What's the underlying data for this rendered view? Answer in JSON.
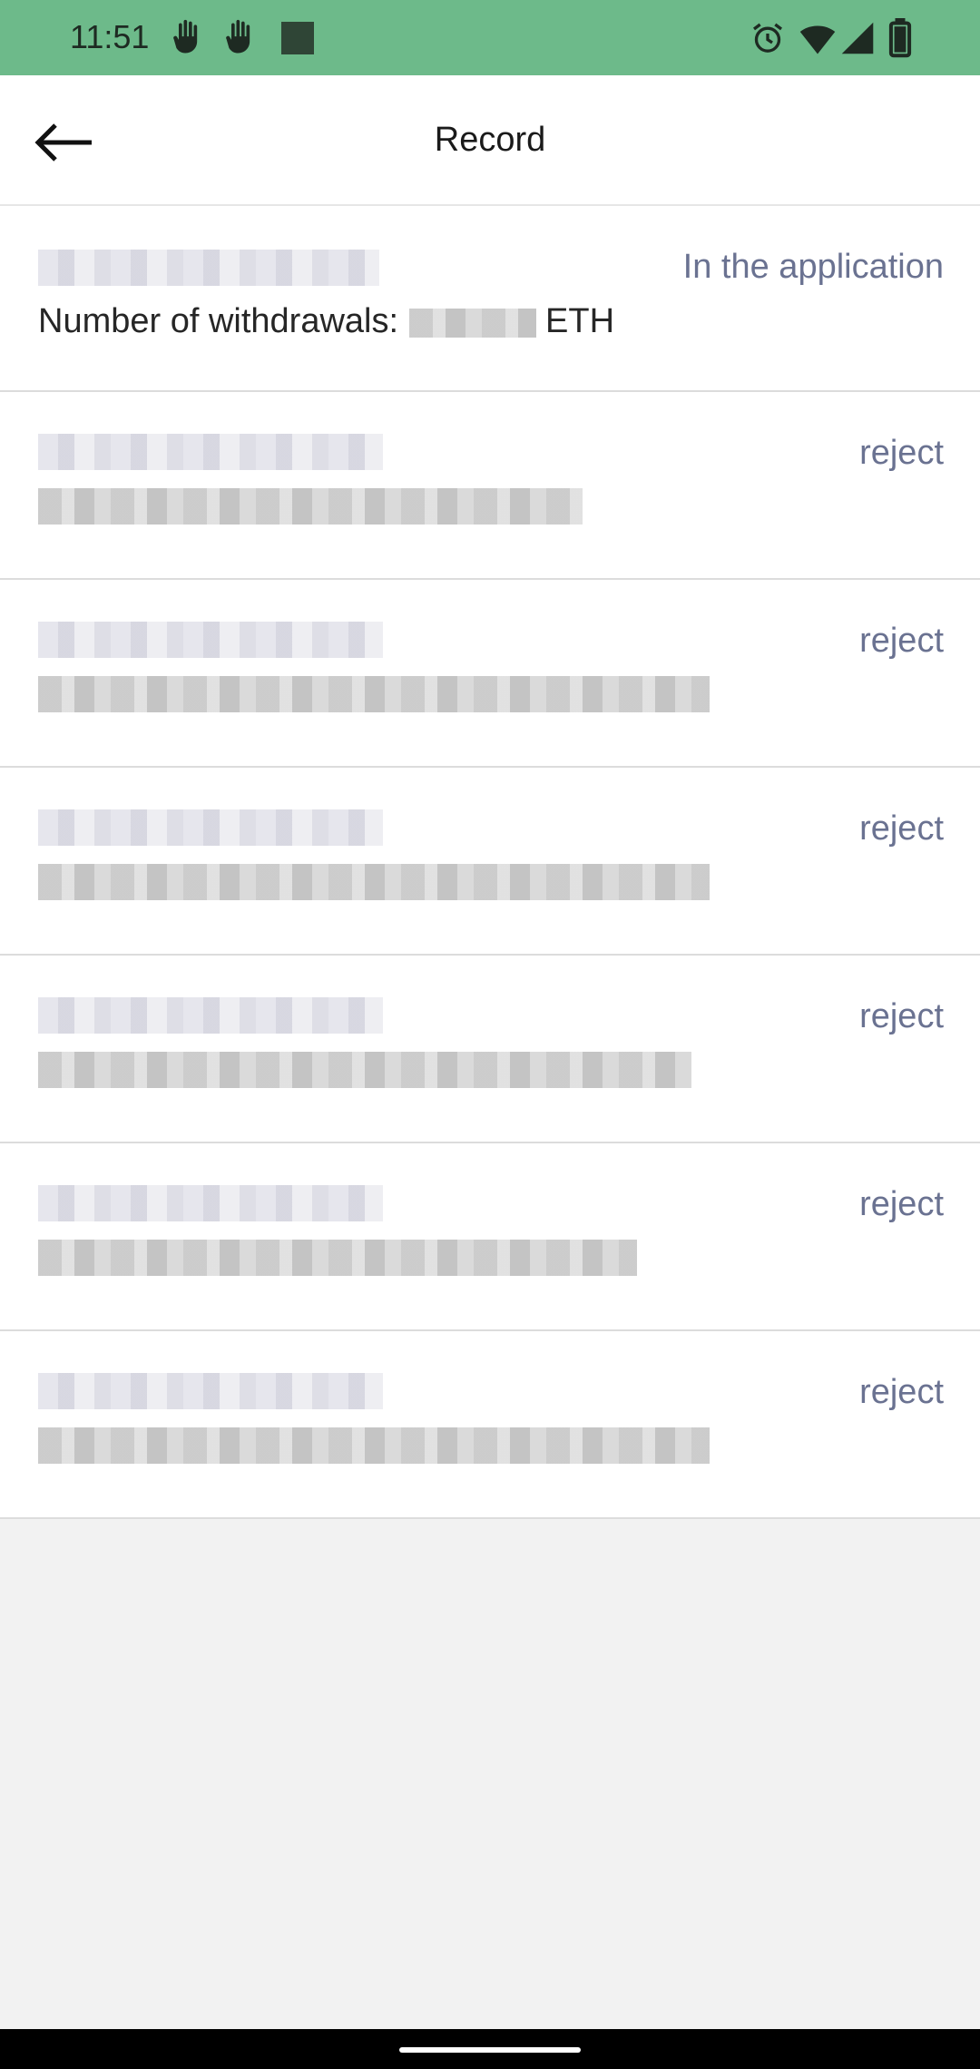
{
  "status_bar": {
    "time": "11:51",
    "left_icons": [
      "hand-wave-icon",
      "hand-wave-icon",
      "square-notification-icon"
    ],
    "right_icons": [
      "alarm-icon",
      "wifi-icon",
      "signal-icon",
      "battery-icon"
    ],
    "background_color": "#6dba8a"
  },
  "header": {
    "back_icon": "arrow-left-icon",
    "title": "Record"
  },
  "summary": {
    "status": "In the application",
    "amount_label": "Number of withdrawals:",
    "amount_currency": "ETH"
  },
  "records": [
    {
      "status": "reject"
    },
    {
      "status": "reject"
    },
    {
      "status": "reject"
    },
    {
      "status": "reject"
    },
    {
      "status": "reject"
    },
    {
      "status": "reject"
    }
  ],
  "colors": {
    "accent_status": "#6a7291",
    "page_background": "#f2f2f2"
  }
}
